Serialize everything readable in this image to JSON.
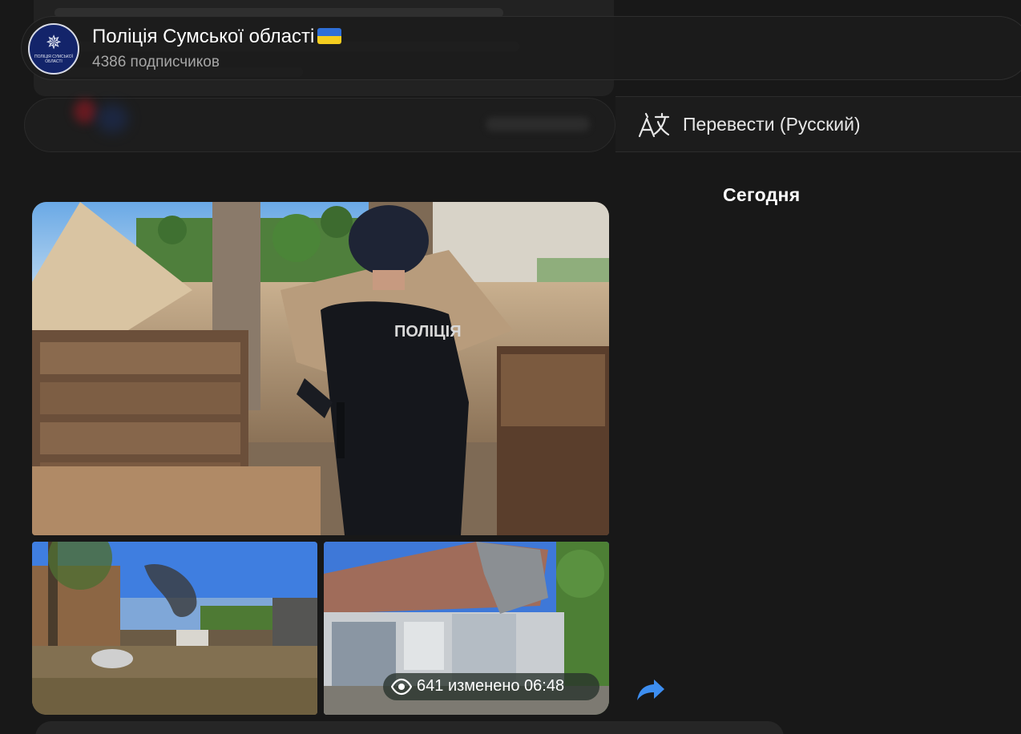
{
  "channel": {
    "title": "Поліція Сумської області",
    "subscribers": "4386 подписчиков",
    "avatar_text": "ПОЛІЦІЯ СУМСЬКОЇ ОБЛАСТІ",
    "flag_icon": "ukraine-flag-icon"
  },
  "translate": {
    "label": "Перевести (Русский)",
    "icon": "translate-icon"
  },
  "date_separator": "Сегодня",
  "post": {
    "photo_label": "ПОЛІЦІЯ",
    "views": "641",
    "edited_time": "изменено 06:48",
    "icons": {
      "views": "eye-icon",
      "share": "share-arrow-icon"
    }
  },
  "colors": {
    "background": "#181818",
    "header_bg": "#1c1c1c",
    "secondary_text": "#a6a6a6",
    "accent_blue": "#3d8ef0",
    "flag_blue": "#2f6fd8",
    "flag_yellow": "#f4cd1f"
  }
}
